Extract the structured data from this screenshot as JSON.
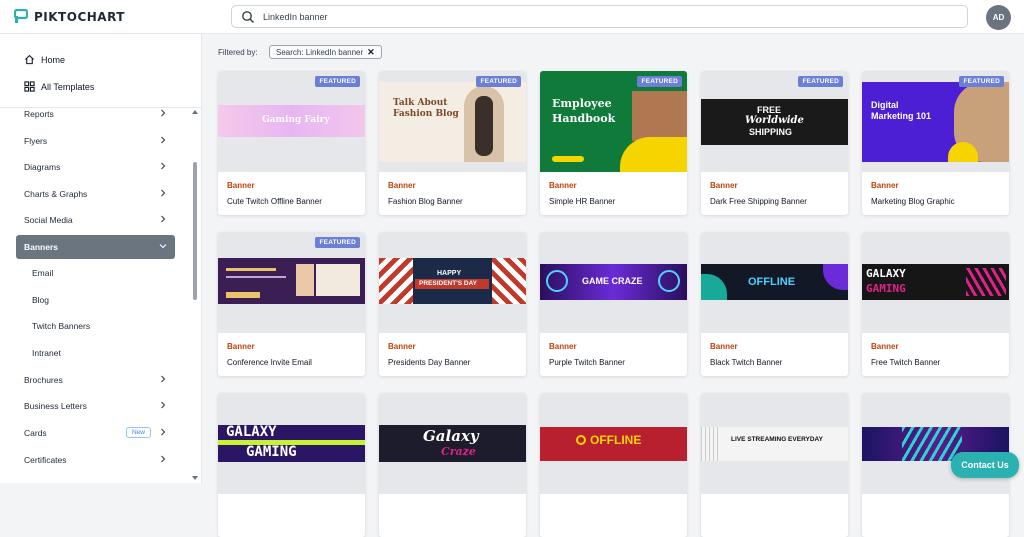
{
  "header": {
    "brand": "PIKTOCHART",
    "search_value": "LinkedIn banner",
    "avatar_initials": "AD"
  },
  "sidebar": {
    "top_items": [
      {
        "label": "Home",
        "icon": "home-icon"
      },
      {
        "label": "All Templates",
        "icon": "grid-icon"
      }
    ],
    "items": [
      {
        "label": "Reports",
        "chevron": "right"
      },
      {
        "label": "Flyers",
        "chevron": "right"
      },
      {
        "label": "Diagrams",
        "chevron": "right"
      },
      {
        "label": "Charts & Graphs",
        "chevron": "right"
      },
      {
        "label": "Social Media",
        "chevron": "right"
      },
      {
        "label": "Banners",
        "chevron": "down",
        "active": true
      },
      {
        "label": "Email",
        "sub": true
      },
      {
        "label": "Blog",
        "sub": true
      },
      {
        "label": "Twitch Banners",
        "sub": true
      },
      {
        "label": "Intranet",
        "sub": true
      },
      {
        "label": "Brochures",
        "chevron": "right"
      },
      {
        "label": "Business Letters",
        "chevron": "right"
      },
      {
        "label": "Cards",
        "chevron": "right",
        "badge": "New"
      },
      {
        "label": "Certificates",
        "chevron": "right"
      }
    ]
  },
  "filter": {
    "label": "Filtered by:",
    "chip": "Search:  LinkedIn banner"
  },
  "featured_label": "FEATURED",
  "cards": [
    {
      "category": "Banner",
      "title": "Cute Twitch Offline Banner",
      "featured": true,
      "art_text": "Welcome to\nGaming Fairy"
    },
    {
      "category": "Banner",
      "title": "Fashion Blog Banner",
      "featured": true,
      "art_text": "Talk About\nFashion Blog"
    },
    {
      "category": "Banner",
      "title": "Simple HR Banner",
      "featured": true,
      "art_text": "Employee\nHandbook"
    },
    {
      "category": "Banner",
      "title": "Dark Free Shipping Banner",
      "featured": true,
      "art_text": "FREE\nWorldwide\nSHIPPING"
    },
    {
      "category": "Banner",
      "title": "Marketing Blog Graphic",
      "featured": true,
      "art_text": "Digital\nMarketing 101"
    },
    {
      "category": "Banner",
      "title": "Conference Invite Email",
      "featured": true,
      "art_text": ""
    },
    {
      "category": "Banner",
      "title": "Presidents Day Banner",
      "featured": false,
      "art_text": "HAPPY\nPRESIDENT'S DAY"
    },
    {
      "category": "Banner",
      "title": "Purple Twitch Banner",
      "featured": false,
      "art_text": "GAME CRAZE"
    },
    {
      "category": "Banner",
      "title": "Black Twitch Banner",
      "featured": false,
      "art_text": "OFFLINE"
    },
    {
      "category": "Banner",
      "title": "Free Twitch Banner",
      "featured": false,
      "art_text": "GALAXY\nGAMING"
    },
    {
      "category": "",
      "title": "",
      "featured": false,
      "art_text": "GALAXY\nGAMING"
    },
    {
      "category": "",
      "title": "",
      "featured": false,
      "art_text": "Galaxy\nCraze"
    },
    {
      "category": "",
      "title": "",
      "featured": false,
      "art_text": "OFFLINE"
    },
    {
      "category": "",
      "title": "",
      "featured": false,
      "art_text": "LIVE STREAMING EVERYDAY"
    },
    {
      "category": "",
      "title": "",
      "featured": false,
      "art_text": ""
    }
  ],
  "contact_button": "Contact Us",
  "colors": {
    "accent_teal": "#2bb1b1",
    "featured_badge": "#6b7fd6",
    "category_orange": "#c2410c",
    "sidebar_active": "#6b7580"
  }
}
